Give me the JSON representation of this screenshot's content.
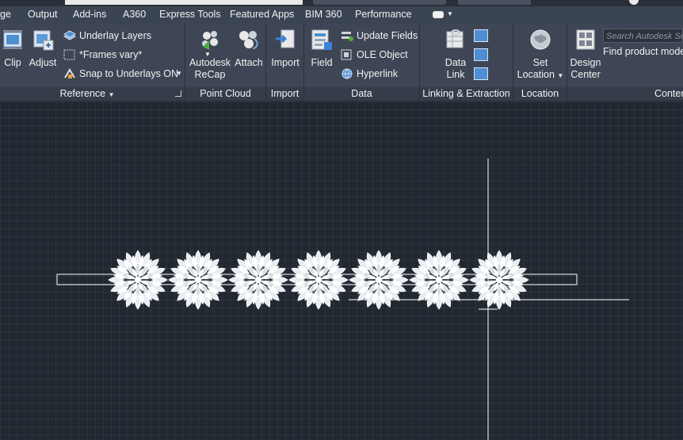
{
  "tabs": [
    "ge",
    "Output",
    "Add-ins",
    "A360",
    "Express Tools",
    "Featured Apps",
    "BIM 360",
    "Performance"
  ],
  "ribbon": {
    "reference": {
      "label": "Reference",
      "clip": "Clip",
      "adjust": "Adjust",
      "underlay_layers": "Underlay Layers",
      "frames_vary": "*Frames vary*",
      "snap": "Snap to Underlays ON"
    },
    "point_cloud": {
      "label": "Point Cloud",
      "recap_line1": "Autodesk",
      "recap_line2": "ReCap",
      "attach": "Attach"
    },
    "import": {
      "label": "Import",
      "import": "Import"
    },
    "data": {
      "label": "Data",
      "field": "Field",
      "update_fields": "Update Fields",
      "ole_object": "OLE Object",
      "hyperlink": "Hyperlink"
    },
    "linking": {
      "label": "Linking & Extraction",
      "data_link_line1": "Data",
      "data_link_line2": "Link"
    },
    "location": {
      "label": "Location",
      "set_location_line1": "Set",
      "set_location_line2": "Location"
    },
    "content": {
      "label": "Content",
      "design_center_line1": "Design",
      "design_center_line2": "Center",
      "search_placeholder": "Search Autodesk Seek",
      "find_product": "Find product model"
    }
  },
  "drawing": {
    "ornament_count": 7
  },
  "colors": {
    "canvas": "#212830",
    "ribbon": "#3e4655",
    "tabbar": "#3b4453"
  }
}
